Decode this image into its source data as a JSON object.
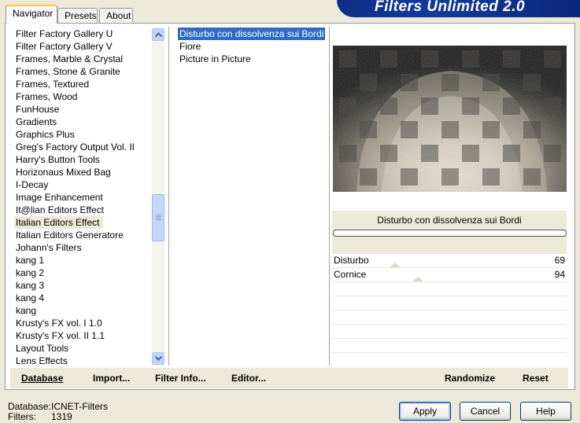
{
  "window": {
    "title": "Filters Unlimited 2.0",
    "banner_color": "#0d2f86"
  },
  "tabs": [
    {
      "label": "Navigator",
      "active": true
    },
    {
      "label": "Presets",
      "active": false
    },
    {
      "label": "About",
      "active": false
    }
  ],
  "categories": {
    "items": [
      "Filter Factory Gallery U",
      "Filter Factory Gallery V",
      "Frames, Marble & Crystal",
      "Frames, Stone & Granite",
      "Frames, Textured",
      "Frames, Wood",
      "FunHouse",
      "Gradients",
      "Graphics Plus",
      "Greg's Factory Output Vol. II",
      "Harry's Button Tools",
      "Horizonaus Mixed Bag",
      "I-Decay",
      "Image Enhancement",
      "It@lian Editors Effect",
      "Italian Editors Effect",
      "Italian Editors Generatore",
      "Johann's Filters",
      "kang 1",
      "kang 2",
      "kang 3",
      "kang 4",
      "kang",
      "Krusty's FX vol. I 1.0",
      "Krusty's FX vol. II 1.1",
      "Layout Tools",
      "Lens Effects"
    ],
    "selected_index": 15
  },
  "filters": {
    "items": [
      "Disturbo con dissolvenza sui Bordi",
      "Fiore",
      "Picture in Picture"
    ],
    "selected_index": 0
  },
  "preview": {
    "filter_name": "Disturbo con dissolvenza sui Bordi",
    "progress": 0
  },
  "params": [
    {
      "label": "Disturbo",
      "value": "69"
    },
    {
      "label": "Cornice",
      "value": "94"
    }
  ],
  "toolbar": {
    "database_label": "Database",
    "import_label": "Import...",
    "filter_info_label": "Filter Info...",
    "editor_label": "Editor...",
    "randomize_label": "Randomize",
    "reset_label": "Reset"
  },
  "status": {
    "database_key": "Database:",
    "database_value": "ICNET-Filters",
    "filters_key": "Filters:",
    "filters_value": "1319"
  },
  "buttons": {
    "apply": "Apply",
    "cancel": "Cancel",
    "help": "Help"
  }
}
